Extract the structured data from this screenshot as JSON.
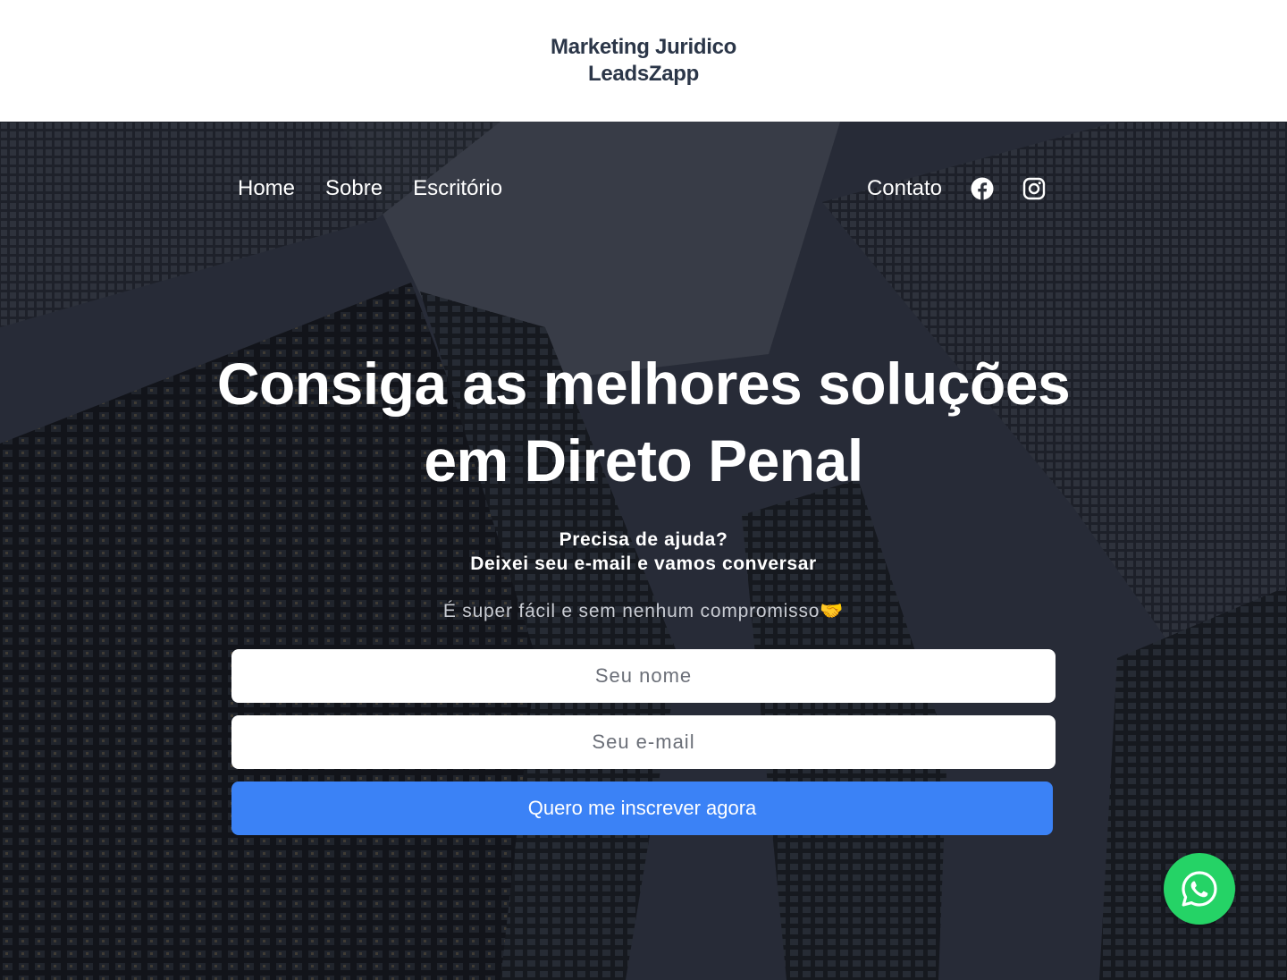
{
  "brand": {
    "line1": "Marketing Juridico",
    "line2": "LeadsZapp"
  },
  "nav": {
    "left": [
      "Home",
      "Sobre",
      "Escritório"
    ],
    "right": "Contato",
    "icons": [
      "facebook-icon",
      "instagram-icon"
    ]
  },
  "hero": {
    "headline_line1": "Consiga as melhores soluções",
    "headline_line2": "em Direto Penal",
    "help_line1": "Precisa de ajuda?",
    "help_line2": "Deixei seu e-mail e vamos conversar",
    "note": "É super fácil e sem nenhum compromisso🤝"
  },
  "form": {
    "name_placeholder": "Seu nome",
    "email_placeholder": "Seu e-mail",
    "submit_label": "Quero me inscrever agora"
  },
  "floating": {
    "icon": "whatsapp-icon"
  },
  "colors": {
    "brand_text": "#2b3648",
    "button": "#3b82f6",
    "whatsapp": "#25d366"
  }
}
